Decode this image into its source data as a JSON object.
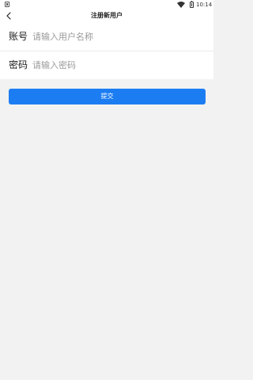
{
  "status_bar": {
    "time": "10:14",
    "icons": [
      "sim-icon",
      "wifi-icon",
      "battery-icon"
    ]
  },
  "nav": {
    "back_icon": "chevron-left-icon",
    "title": "注册新用户"
  },
  "form": {
    "account": {
      "label": "账号",
      "value": "",
      "placeholder": "请输入用户名称"
    },
    "password": {
      "label": "密码",
      "value": "",
      "placeholder": "请输入密码"
    }
  },
  "submit": {
    "label": "提交"
  },
  "colors": {
    "accent": "#1c7df2",
    "background": "#f2f2f2",
    "surface": "#ffffff",
    "placeholder": "#9a9a9a"
  }
}
